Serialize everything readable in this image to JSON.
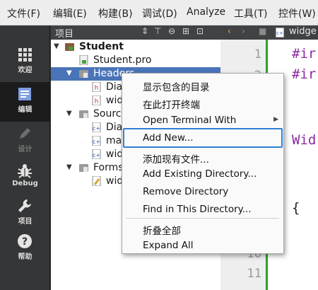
{
  "menubar": {
    "items": [
      "文件(F)",
      "编辑(E)",
      "构建(B)",
      "调试(D)",
      "Analyze",
      "工具(T)",
      "控件(W)"
    ]
  },
  "modes": [
    {
      "label": "欢迎",
      "icon": "grid-icon",
      "state": "normal"
    },
    {
      "label": "编辑",
      "icon": "edit-document-icon",
      "state": "active"
    },
    {
      "label": "设计",
      "icon": "pencil-icon",
      "state": "disabled"
    },
    {
      "label": "Debug",
      "icon": "bug-icon",
      "state": "normal"
    },
    {
      "label": "项目",
      "icon": "wrench-icon",
      "state": "normal"
    },
    {
      "label": "帮助",
      "icon": "help-icon",
      "state": "normal"
    }
  ],
  "project_pane": {
    "title": "项目",
    "tree": {
      "root": "Student",
      "pro_file": "Student.pro",
      "headers": {
        "label": "Headers",
        "files": [
          "Dia",
          "wid"
        ]
      },
      "sources": {
        "label": "Source",
        "files": [
          "Dia",
          "ma",
          "wid"
        ]
      },
      "forms": {
        "label": "Forms",
        "files": [
          "wid"
        ]
      }
    }
  },
  "editor": {
    "file_tab": "widge",
    "line_numbers": [
      "1",
      "2",
      "10",
      "11"
    ],
    "code_fragments": [
      "#ir",
      "#ir",
      "Wid",
      "{"
    ]
  },
  "context_menu": {
    "items": [
      "显示包含的目录",
      "在此打开终端",
      "Open Terminal With",
      "Add New...",
      "添加现有文件...",
      "Add Existing Directory...",
      "Remove Directory",
      "Find in This Directory...",
      "折叠全部",
      "Expand All"
    ],
    "highlighted_index": 3
  },
  "colors": {
    "selection": "#4a74b8",
    "highlight_border": "#2f7fd6",
    "keyword_purple": "#8a2b9e",
    "modified_bar": "#2da12d"
  }
}
